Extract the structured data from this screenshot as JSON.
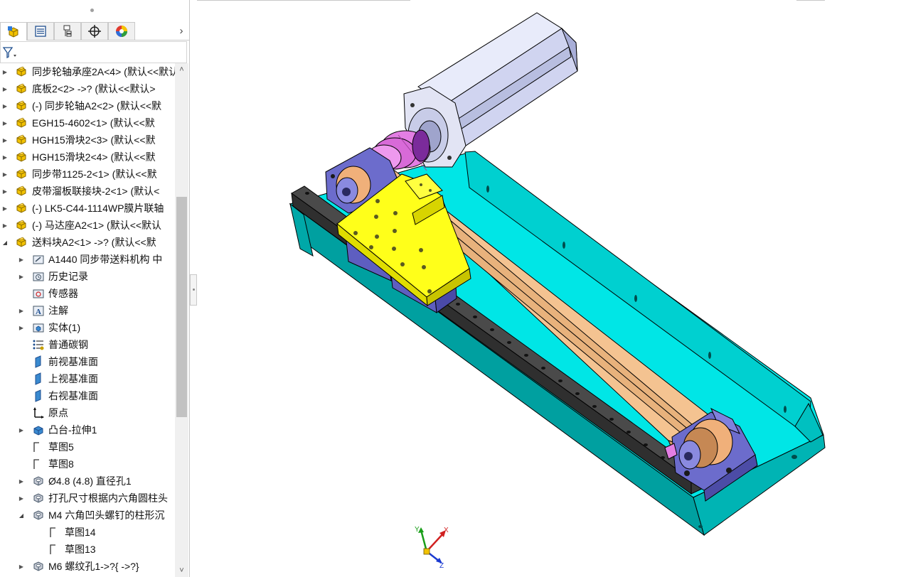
{
  "tabs": [
    {
      "name": "feature-manager",
      "icon": "feature-tree-icon"
    },
    {
      "name": "property-manager",
      "icon": "property-list-icon"
    },
    {
      "name": "configuration-manager",
      "icon": "configuration-icon"
    },
    {
      "name": "dimxpert-manager",
      "icon": "crosshair-icon"
    },
    {
      "name": "display-manager",
      "icon": "appearance-icon"
    }
  ],
  "filter": {
    "icon": "filter-icon"
  },
  "tree": [
    {
      "label": "同步轮轴承座2A<4> (默认<<默认>",
      "icon": "part-icon",
      "expand": "collapsed",
      "level": 0
    },
    {
      "label": "底板2<2> ->? (默认<<默认>",
      "icon": "part-icon",
      "expand": "collapsed",
      "level": 0
    },
    {
      "label": "(-) 同步轮轴A2<2> (默认<<默",
      "icon": "part-icon",
      "expand": "collapsed",
      "level": 0
    },
    {
      "label": "EGH15-4602<1> (默认<<默",
      "icon": "part-icon",
      "expand": "collapsed",
      "level": 0
    },
    {
      "label": "HGH15滑块2<3> (默认<<默",
      "icon": "part-icon",
      "expand": "collapsed",
      "level": 0
    },
    {
      "label": "HGH15滑块2<4> (默认<<默",
      "icon": "part-icon",
      "expand": "collapsed",
      "level": 0
    },
    {
      "label": "同步带1125-2<1> (默认<<默",
      "icon": "part-icon",
      "expand": "collapsed",
      "level": 0
    },
    {
      "label": "皮带溜板联接块-2<1> (默认<",
      "icon": "part-icon",
      "expand": "collapsed",
      "level": 0
    },
    {
      "label": "(-) LK5-C44-1114WP膜片联轴",
      "icon": "part-icon",
      "expand": "collapsed",
      "level": 0
    },
    {
      "label": "(-) 马达座A2<1> (默认<<默认",
      "icon": "part-icon",
      "expand": "collapsed",
      "level": 0
    },
    {
      "label": "送料块A2<1> ->? (默认<<默",
      "icon": "part-icon",
      "expand": "expanded",
      "level": 0
    },
    {
      "label": "A1440 同步带送料机构 中",
      "icon": "folder-link-icon",
      "expand": "collapsed",
      "level": 1
    },
    {
      "label": "历史记录",
      "icon": "history-folder-icon",
      "expand": "collapsed",
      "level": 1
    },
    {
      "label": "传感器",
      "icon": "sensor-icon",
      "expand": "none",
      "level": 1
    },
    {
      "label": "注解",
      "icon": "annotation-icon",
      "expand": "collapsed",
      "level": 1
    },
    {
      "label": "实体(1)",
      "icon": "solid-bodies-icon",
      "expand": "collapsed",
      "level": 1
    },
    {
      "label": "普通碳钢",
      "icon": "material-icon",
      "expand": "none",
      "level": 1
    },
    {
      "label": "前视基准面",
      "icon": "plane-icon",
      "expand": "none",
      "level": 1
    },
    {
      "label": "上视基准面",
      "icon": "plane-icon",
      "expand": "none",
      "level": 1
    },
    {
      "label": "右视基准面",
      "icon": "plane-icon",
      "expand": "none",
      "level": 1
    },
    {
      "label": "原点",
      "icon": "origin-icon",
      "expand": "none",
      "level": 1
    },
    {
      "label": "凸台-拉伸1",
      "icon": "extrude-icon",
      "expand": "collapsed",
      "level": 1
    },
    {
      "label": "草图5",
      "icon": "sketch-icon",
      "expand": "none",
      "level": 1
    },
    {
      "label": "草图8",
      "icon": "sketch-icon",
      "expand": "none",
      "level": 1
    },
    {
      "label": "Ø4.8 (4.8) 直径孔1",
      "icon": "hole-icon",
      "expand": "collapsed",
      "level": 1
    },
    {
      "label": "打孔尺寸根据内六角圆柱头",
      "icon": "hole-icon",
      "expand": "collapsed",
      "level": 1
    },
    {
      "label": "M4 六角凹头螺钉的柱形沉",
      "icon": "hole-icon",
      "expand": "expanded",
      "level": 1
    },
    {
      "label": "草图14",
      "icon": "sketch-icon",
      "expand": "none",
      "level": 2
    },
    {
      "label": "草图13",
      "icon": "sketch-icon",
      "expand": "none",
      "level": 2
    },
    {
      "label": "M6 螺纹孔1->?{ ->?}",
      "icon": "hole-icon",
      "expand": "collapsed",
      "level": 1
    }
  ],
  "scroll": {
    "up_icon": "scroll-up-arrow-icon",
    "down_icon": "scroll-down-arrow-icon"
  },
  "triad": {
    "x_label": "X",
    "y_label": "Y",
    "z_label": "Z"
  },
  "colors": {
    "base_plate": "#00e5e5",
    "rail": "#585858",
    "belt": "#f4c391",
    "slide_block": "#ffff1a",
    "bearing_block": "#6c6ccc",
    "coupling": "#e37ee3",
    "motor": "#d8dcf4"
  }
}
